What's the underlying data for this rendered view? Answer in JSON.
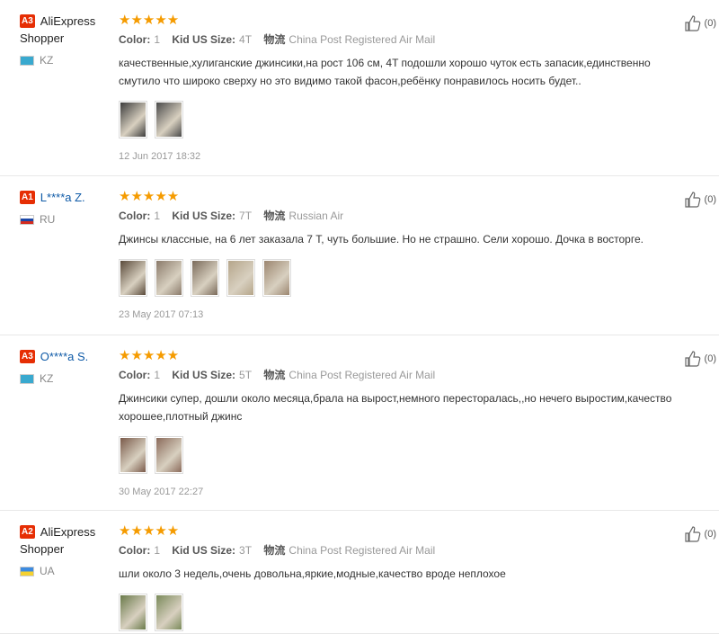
{
  "reviews": [
    {
      "level": "A3",
      "name": "AliExpress Shopper",
      "name_link": false,
      "flag": "kz",
      "country": "KZ",
      "color_label": "Color:",
      "color": "1",
      "size_label": "Kid US Size:",
      "size": "4T",
      "ship_label": "物流",
      "ship": "China Post Registered Air Mail",
      "text": "качественные,хулиганские джинсики,на рост 106 см, 4T подошли хорошо чуток есть запасик,единственно смутило что широко сверху но это видимо такой фасон,ребёнку понравилось носить будет..",
      "date": "12 Jun 2017 18:32",
      "helpful": "(0)",
      "pics": [
        "#3c3c3c",
        "#4a4a4a"
      ]
    },
    {
      "level": "A1",
      "name": "L****a Z.",
      "name_link": true,
      "flag": "ru",
      "country": "RU",
      "color_label": "Color:",
      "color": "1",
      "size_label": "Kid US Size:",
      "size": "7T",
      "ship_label": "物流",
      "ship": "Russian Air",
      "text": "Джинсы классные, на 6 лет заказала 7 Т, чуть большие. Но не страшно. Сели хорошо. Дочка в восторге.",
      "date": "23 May 2017 07:13",
      "helpful": "(0)",
      "pics": [
        "#5a4a3a",
        "#8a7a6a",
        "#7a6a5a",
        "#b5a58a",
        "#9c8670"
      ]
    },
    {
      "level": "A3",
      "name": "O****a S.",
      "name_link": true,
      "flag": "kz",
      "country": "KZ",
      "color_label": "Color:",
      "color": "1",
      "size_label": "Kid US Size:",
      "size": "5T",
      "ship_label": "物流",
      "ship": "China Post Registered Air Mail",
      "text": "Джинсики супер, дошли около месяца,брала на вырост,немного перестоpалась,,но нечего выростим,качество хорошее,плотный джинс",
      "date": "30 May 2017 22:27",
      "helpful": "(0)",
      "pics": [
        "#7a5a4a",
        "#8a6a5a"
      ]
    },
    {
      "level": "A2",
      "name": "AliExpress Shopper",
      "name_link": false,
      "flag": "ua",
      "country": "UA",
      "color_label": "Color:",
      "color": "1",
      "size_label": "Kid US Size:",
      "size": "3T",
      "ship_label": "物流",
      "ship": "China Post Registered Air Mail",
      "text": "шли около 3 недель,очень довольна,яркие,модные,качество вроде неплохое",
      "date": "",
      "helpful": "(0)",
      "pics": [
        "#6a7a4a",
        "#7a8a5a"
      ]
    }
  ],
  "stars": "★★★★★",
  "colors": {
    "accent": "#e62e04",
    "star": "#f59b00",
    "link": "#0e5aa7"
  }
}
